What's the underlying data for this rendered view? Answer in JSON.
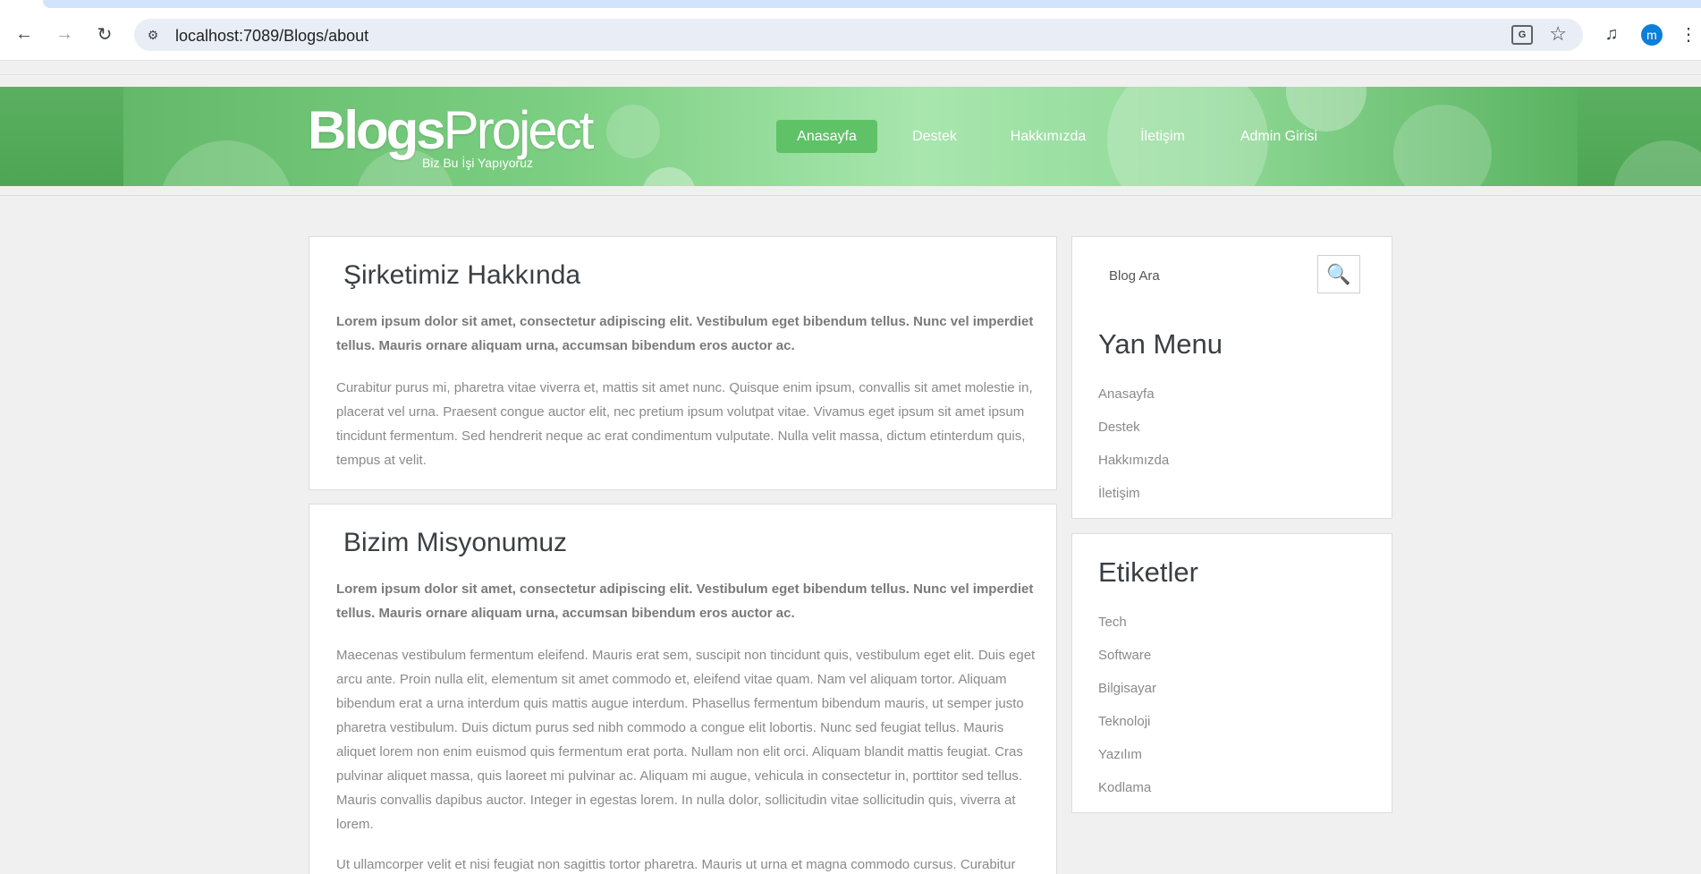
{
  "browser": {
    "url": "localhost:7089/Blogs/about",
    "profile_initial": "m"
  },
  "site": {
    "logo_bold": "Blogs",
    "logo_light": "Project",
    "tagline": "Biz Bu İşi Yapıyoruz",
    "nav": [
      {
        "label": "Anasayfa",
        "active": true
      },
      {
        "label": "Destek",
        "active": false
      },
      {
        "label": "Hakkımızda",
        "active": false
      },
      {
        "label": "İletişim",
        "active": false
      },
      {
        "label": "Admin Girisi",
        "active": false
      }
    ]
  },
  "main": {
    "sections": [
      {
        "title": "Şirketimiz  Hakkında",
        "lead": "Lorem ipsum dolor sit amet, consectetur adipiscing elit. Vestibulum eget bibendum tellus. Nunc vel imperdiet tellus. Mauris ornare aliquam urna, accumsan bibendum eros auctor ac.",
        "body": "Curabitur purus mi, pharetra vitae viverra et, mattis sit amet nunc. Quisque enim ipsum, convallis sit amet molestie in, placerat vel urna. Praesent congue auctor elit, nec pretium ipsum volutpat vitae. Vivamus eget ipsum sit amet ipsum tincidunt fermentum. Sed hendrerit neque ac erat condimentum vulputate. Nulla velit massa, dictum etinterdum quis, tempus at velit."
      },
      {
        "title": "Bizim  Misyonumuz",
        "lead": "Lorem ipsum dolor sit amet, consectetur adipiscing elit. Vestibulum eget bibendum tellus. Nunc vel imperdiet tellus. Mauris ornare aliquam urna, accumsan bibendum eros auctor ac.",
        "body": "Maecenas vestibulum fermentum eleifend. Mauris erat sem, suscipit non tincidunt quis, vestibulum eget elit. Duis eget arcu ante. Proin nulla elit, elementum sit amet commodo et, eleifend vitae quam. Nam vel aliquam tortor. Aliquam bibendum erat a urna interdum quis mattis augue interdum. Phasellus fermentum bibendum mauris, ut semper justo pharetra vestibulum. Duis dictum purus sed nibh commodo a congue elit lobortis. Nunc sed feugiat tellus. Mauris aliquet lorem non enim euismod quis fermentum erat porta. Nullam non elit orci. Aliquam blandit mattis feugiat. Cras pulvinar aliquet massa, quis laoreet mi pulvinar ac. Aliquam mi augue, vehicula in consectetur in, porttitor sed tellus. Mauris convallis dapibus auctor. Integer in egestas lorem. In nulla dolor, sollicitudin vitae sollicitudin quis, viverra at lorem.",
        "body2": "Ut ullamcorper velit et nisi feugiat non sagittis tortor pharetra. Mauris ut urna et magna commodo cursus. Curabitur"
      }
    ]
  },
  "sidebar": {
    "search_placeholder": "Blog Ara",
    "menu_title": "Yan Menu",
    "menu_items": [
      "Anasayfa",
      "Destek",
      "Hakkımızda",
      "İletişim"
    ],
    "tags_title": "Etiketler",
    "tags": [
      "Tech",
      "Software",
      "Bilgisayar",
      "Teknoloji",
      "Yazılım",
      "Kodlama"
    ]
  }
}
